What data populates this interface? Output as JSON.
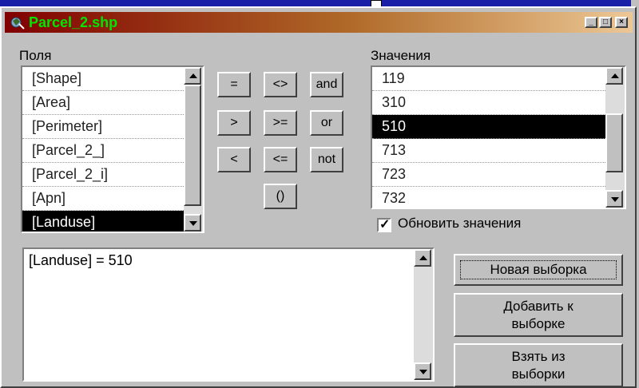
{
  "window": {
    "title": "Parcel_2.shp"
  },
  "fields": {
    "label": "Поля",
    "items": [
      "[Shape]",
      "[Area]",
      "[Perimeter]",
      "[Parcel_2_]",
      "[Parcel_2_i]",
      "[Apn]",
      "[Landuse]"
    ],
    "selected_index": 6
  },
  "operators": [
    [
      "=",
      "<>",
      "and"
    ],
    [
      ">",
      ">=",
      "or"
    ],
    [
      "<",
      "<=",
      "not"
    ],
    [
      "()"
    ]
  ],
  "values": {
    "label": "Значения",
    "items": [
      "119",
      "310",
      "510",
      "713",
      "723",
      "732"
    ],
    "selected_index": 2
  },
  "update_values": {
    "label": "Обновить значения",
    "checked": true
  },
  "expression": {
    "text": "[Landuse] = 510"
  },
  "buttons": {
    "new_selection": "Новая выборка",
    "add_line1": "Добавить к",
    "add_line2": "выборке",
    "take_line1": "Взять из",
    "take_line2": "выборки"
  }
}
